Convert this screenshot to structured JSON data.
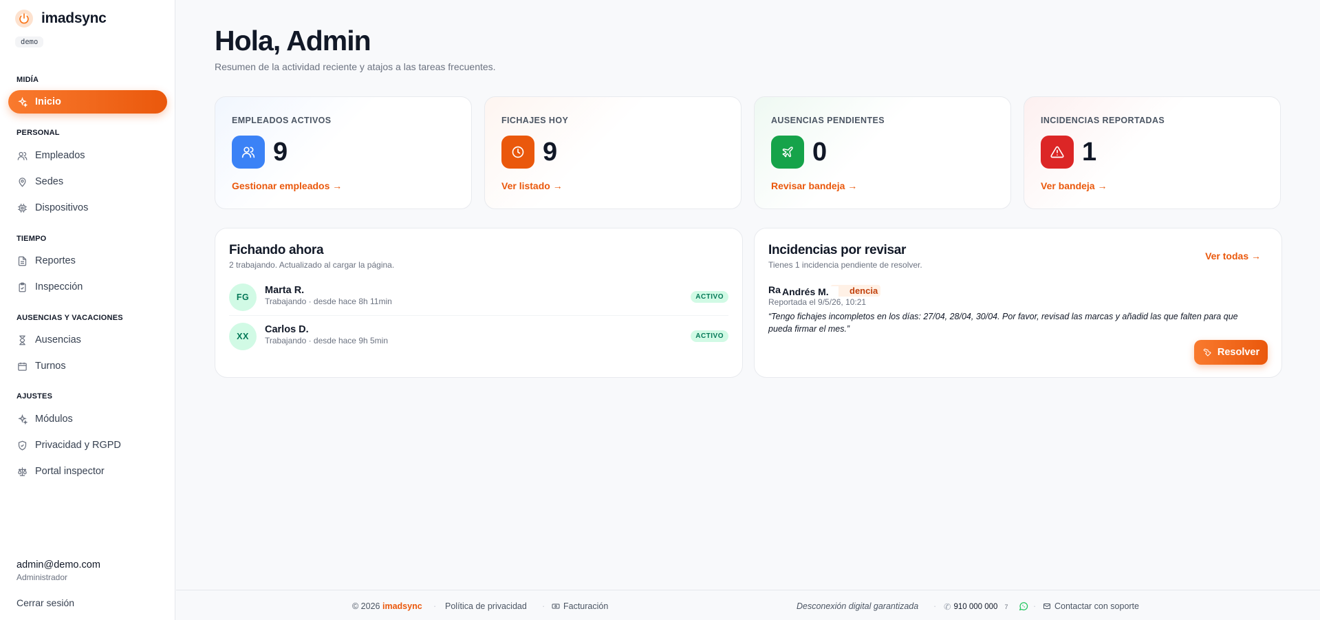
{
  "brand": {
    "name": "imadsync",
    "env": "demo",
    "accent": "#ea580c"
  },
  "nav": {
    "sections": [
      {
        "title": "MIDÍA"
      },
      {
        "title": "PERSONAL"
      },
      {
        "title": "TIEMPO"
      },
      {
        "title": "AUSENCIAS Y VACACIONES"
      },
      {
        "title": "AJUSTES"
      }
    ],
    "items": [
      {
        "label": "Inicio",
        "icon": "sparkle-icon",
        "active": true
      },
      {
        "label": "Empleados",
        "icon": "users-icon"
      },
      {
        "label": "Sedes",
        "icon": "map-pin-icon"
      },
      {
        "label": "Dispositivos",
        "icon": "chip-icon"
      },
      {
        "label": "Reportes",
        "icon": "file-text-icon"
      },
      {
        "label": "Inspección",
        "icon": "clipboard-check-icon"
      },
      {
        "label": "Ausencias",
        "icon": "hourglass-icon"
      },
      {
        "label": "Turnos",
        "icon": "calendar-icon"
      },
      {
        "label": "Módulos",
        "icon": "sparkle-icon"
      },
      {
        "label": "Privacidad y RGPD",
        "icon": "shield-icon"
      },
      {
        "label": "Portal inspector",
        "icon": "scale-icon"
      }
    ]
  },
  "user": {
    "email": "admin@demo.com",
    "role": "Administrador",
    "logout": "Cerrar sesión"
  },
  "header": {
    "title": "Hola, Admin",
    "subtitle": "Resumen de la actividad reciente y atajos a las tareas frecuentes."
  },
  "stats": [
    {
      "label": "EMPLEADOS ACTIVOS",
      "value": "9",
      "link": "Gestionar empleados →",
      "icon": "users-icon",
      "color": "#3b82f6"
    },
    {
      "label": "FICHAJES HOY",
      "value": "9",
      "link": "Ver listado →",
      "icon": "clock-icon",
      "color": "#ea580c"
    },
    {
      "label": "AUSENCIAS PENDIENTES",
      "value": "0",
      "link": "Revisar bandeja →",
      "icon": "plane-icon",
      "color": "#16a34a"
    },
    {
      "label": "INCIDENCIAS REPORTADAS",
      "value": "1",
      "link": "Ver bandeja →",
      "icon": "alert-triangle-icon",
      "color": "#dc2626"
    }
  ],
  "working_now": {
    "title": "Fichando ahora",
    "subtitle": "2 trabajando. Actualizado al cargar la página.",
    "rows": [
      {
        "initials": "FG",
        "name": "Marta R.",
        "status": "Trabajando · desde hace 8h 11min",
        "badge": "ACTIVO"
      },
      {
        "initials": "XX",
        "name": "Carlos D.",
        "status": "Trabajando · desde hace 9h 5min",
        "badge": "ACTIVO"
      }
    ]
  },
  "incidents": {
    "title": "Incidencias por revisar",
    "subtitle": "Tienes 1 incidencia pendiente de resolver.",
    "view_all": "Ver todas →",
    "item": {
      "prefix": "Ra",
      "name": "Andrés M.",
      "tag": "dencia",
      "date": "Reportada el 9/5/26, 10:21",
      "quote": "“Tengo fichajes incompletos en los días: 27/04, 28/04, 30/04. Por favor, revisad las marcas y añadid las que falten para que pueda firmar el mes.”",
      "action": "Resolver"
    }
  },
  "footer": {
    "copyright": "© 2026",
    "brand": "imadsync",
    "privacy": "Política de privacidad",
    "billing": "Facturación",
    "tagline": "Desconexión digital garantizada",
    "phone": "910 000 000",
    "phone_suffix": "7",
    "support": "Contactar con soporte"
  }
}
